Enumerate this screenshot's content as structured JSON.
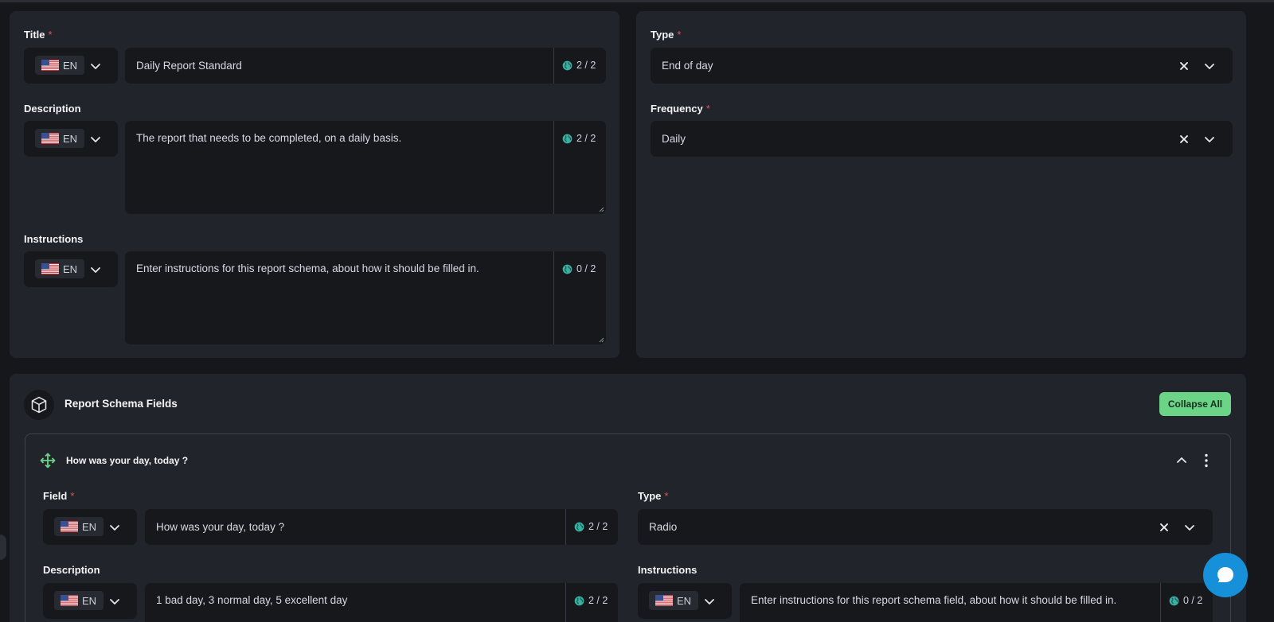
{
  "colors": {
    "background": "#15171b",
    "card": "#22242b",
    "input": "#16181c",
    "accent_green": "#6bd486",
    "required": "#e0554f",
    "chat": "#1690d8"
  },
  "general": {
    "title": {
      "label": "Title",
      "required": "*",
      "lang": "EN",
      "value": "Daily Report Standard",
      "counter": "2 / 2"
    },
    "description": {
      "label": "Description",
      "lang": "EN",
      "value": "The report that needs to be completed, on a daily basis.",
      "counter": "2 / 2"
    },
    "instructions": {
      "label": "Instructions",
      "lang": "EN",
      "placeholder": "Enter instructions for this report schema, about how it should be filled in.",
      "counter": "0 / 2"
    }
  },
  "settings": {
    "type": {
      "label": "Type",
      "required": "*",
      "value": "End of day"
    },
    "frequency": {
      "label": "Frequency",
      "required": "*",
      "value": "Daily"
    }
  },
  "fields_section": {
    "title": "Report Schema Fields",
    "collapse_label": "Collapse All",
    "item": {
      "title": "How was your day, today ?",
      "field": {
        "label": "Field",
        "required": "*",
        "lang": "EN",
        "value": "How was your day, today ?",
        "counter": "2 / 2"
      },
      "type": {
        "label": "Type",
        "required": "*",
        "value": "Radio"
      },
      "description": {
        "label": "Description",
        "lang": "EN",
        "value": "1 bad day, 3 normal day, 5 excellent day",
        "counter": "2 / 2"
      },
      "instructions": {
        "label": "Instructions",
        "lang": "EN",
        "placeholder": "Enter instructions for this report schema field, about how it should be filled in.",
        "counter": "0 / 2"
      }
    }
  },
  "icons": [
    "us-flag-icon",
    "chevron-down-icon",
    "globe-icon",
    "clear-icon",
    "cube-icon",
    "move-icon",
    "chevron-up-icon",
    "more-vertical-icon",
    "chat-icon"
  ]
}
